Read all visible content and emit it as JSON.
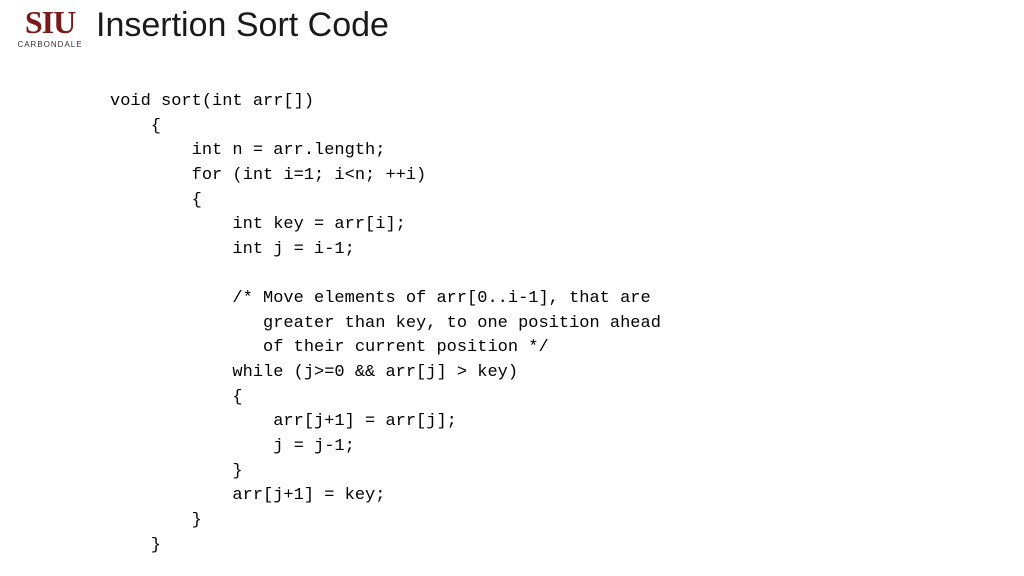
{
  "logo": {
    "brand": "SIU",
    "campus": "CARBONDALE"
  },
  "title": "Insertion Sort Code",
  "code": {
    "l01": "void sort(int arr[])",
    "l02": "    {",
    "l03": "        int n = arr.length;",
    "l04": "        for (int i=1; i<n; ++i)",
    "l05": "        {",
    "l06": "            int key = arr[i];",
    "l07": "            int j = i-1;",
    "l08": "",
    "l09": "            /* Move elements of arr[0..i-1], that are",
    "l10": "               greater than key, to one position ahead",
    "l11": "               of their current position */",
    "l12": "            while (j>=0 && arr[j] > key)",
    "l13": "            {",
    "l14": "                arr[j+1] = arr[j];",
    "l15": "                j = j-1;",
    "l16": "            }",
    "l17": "            arr[j+1] = key;",
    "l18": "        }",
    "l19": "    }"
  }
}
